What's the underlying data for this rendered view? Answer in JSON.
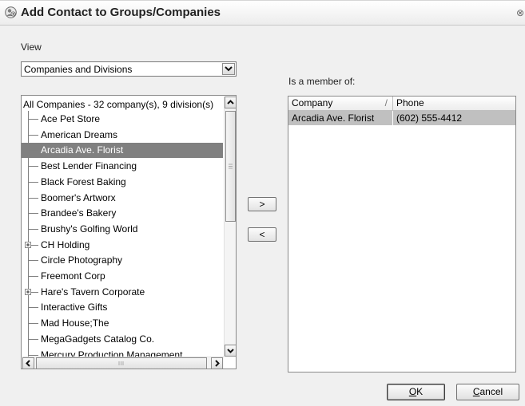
{
  "window": {
    "title": "Add Contact to Groups/Companies",
    "icon": "contact-group-icon",
    "close_glyph": "⊗"
  },
  "view": {
    "label": "View",
    "selected": "Companies and Divisions"
  },
  "tree": {
    "header": "All Companies - 32 company(s), 9 division(s)",
    "items": [
      {
        "label": "Ace Pet Store",
        "expandable": false,
        "selected": false
      },
      {
        "label": "American Dreams",
        "expandable": false,
        "selected": false
      },
      {
        "label": "Arcadia Ave. Florist",
        "expandable": false,
        "selected": true
      },
      {
        "label": "Best Lender Financing",
        "expandable": false,
        "selected": false
      },
      {
        "label": "Black Forest Baking",
        "expandable": false,
        "selected": false
      },
      {
        "label": "Boomer's Artworx",
        "expandable": false,
        "selected": false
      },
      {
        "label": "Brandee's Bakery",
        "expandable": false,
        "selected": false
      },
      {
        "label": "Brushy's Golfing World",
        "expandable": false,
        "selected": false
      },
      {
        "label": "CH Holding",
        "expandable": true,
        "selected": false
      },
      {
        "label": "Circle Photography",
        "expandable": false,
        "selected": false
      },
      {
        "label": "Freemont Corp",
        "expandable": false,
        "selected": false
      },
      {
        "label": "Hare's Tavern Corporate",
        "expandable": true,
        "selected": false
      },
      {
        "label": "Interactive Gifts",
        "expandable": false,
        "selected": false
      },
      {
        "label": "Mad House;The",
        "expandable": false,
        "selected": false
      },
      {
        "label": "MegaGadgets Catalog Co.",
        "expandable": false,
        "selected": false
      },
      {
        "label": "Mercury Production Management",
        "expandable": false,
        "selected": false
      }
    ]
  },
  "buttons": {
    "add": ">",
    "remove": "<",
    "ok": "OK",
    "cancel": "Cancel"
  },
  "member": {
    "label": "Is a member of:",
    "columns": [
      "Company",
      "Phone"
    ],
    "sort_glyph": "/",
    "rows": [
      {
        "company": "Arcadia Ave. Florist",
        "phone": "(602) 555-4412"
      }
    ]
  }
}
